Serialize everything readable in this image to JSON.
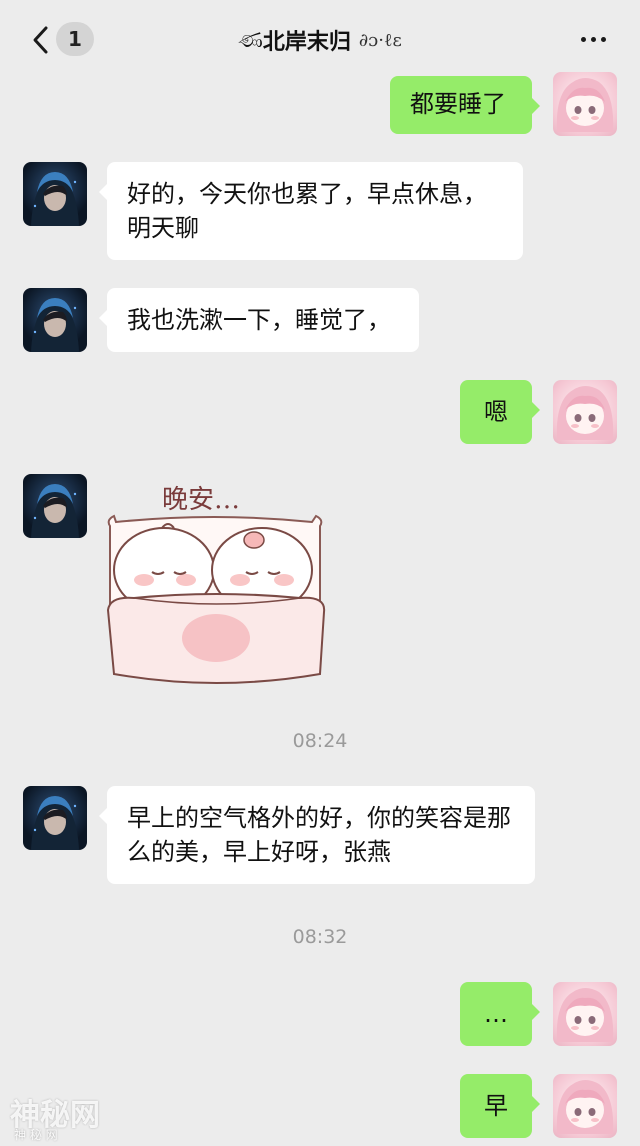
{
  "header": {
    "unread_count": "1",
    "title": "北岸末归",
    "title_prefix": "ණ",
    "title_suffix": "∂ɔ·ℓɛ"
  },
  "messages": [
    {
      "side": "right",
      "text": "都要睡了"
    },
    {
      "side": "left",
      "text": "好的，今天你也累了，早点休息，明天聊"
    },
    {
      "side": "left",
      "text": "我也洗漱一下，睡觉了，"
    },
    {
      "side": "right",
      "text": "嗯"
    },
    {
      "side": "left",
      "type": "sticker",
      "sticker_text": "晚安…"
    },
    {
      "type": "time",
      "text": "08:24"
    },
    {
      "side": "left",
      "text": "早上的空气格外的好，你的笑容是那么的美，早上好呀，张燕"
    },
    {
      "type": "time",
      "text": "08:32"
    },
    {
      "side": "right",
      "text": "…"
    },
    {
      "side": "right",
      "text": "早"
    }
  ],
  "watermark": {
    "main": "神秘网",
    "sub": "神 秘 网"
  },
  "colors": {
    "background": "#ececec",
    "bubble_self": "#95ec69",
    "bubble_other": "#ffffff",
    "timestamp": "#9a9a9a"
  }
}
